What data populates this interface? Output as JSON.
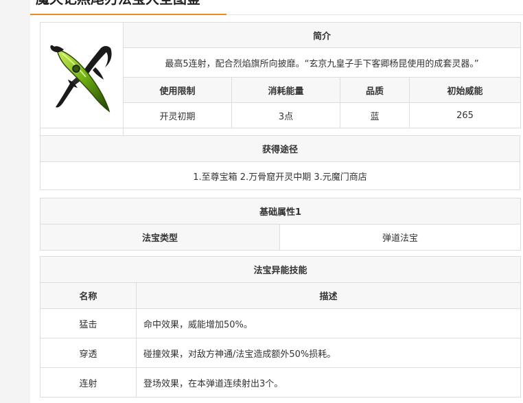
{
  "page": {
    "title": "魔天记燕尾刃法宝大全图鉴"
  },
  "weapon": {
    "name": "燕尾刃",
    "icon": "crossed-blades-icon",
    "intro_header": "简介",
    "intro_text": "最高5连射，配合烈焰旗所向披靡。“玄京九皇子手下客卿杨昆使用的成套灵器。”",
    "stat_headers": [
      "使用限制",
      "消耗能量",
      "品质",
      "初始威能"
    ],
    "stat_values": [
      "开灵初期",
      "3点",
      "蓝",
      "265"
    ]
  },
  "obtain": {
    "header": "获得途径",
    "text": "1.至尊宝箱 2.万骨窟开灵中期 3.元魔门商店"
  },
  "base_attr": {
    "header": "基础属性1",
    "label": "法宝类型",
    "value": "弹道法宝"
  },
  "skills": {
    "header": "法宝异能技能",
    "col_name": "名称",
    "col_desc": "描述",
    "rows": [
      {
        "name": "猛击",
        "desc": "命中效果，威能增加50%。"
      },
      {
        "name": "穿透",
        "desc": "碰撞效果，对敌方神通/法宝造成额外50%损耗。"
      },
      {
        "name": "连射",
        "desc": "登场效果，在本弹道连续射出3个。"
      }
    ]
  },
  "colors": {
    "accent": "#f08a1d",
    "header_bg": "#f7f7f7",
    "border": "#dddddd",
    "blade_green": "#7cc11a"
  }
}
